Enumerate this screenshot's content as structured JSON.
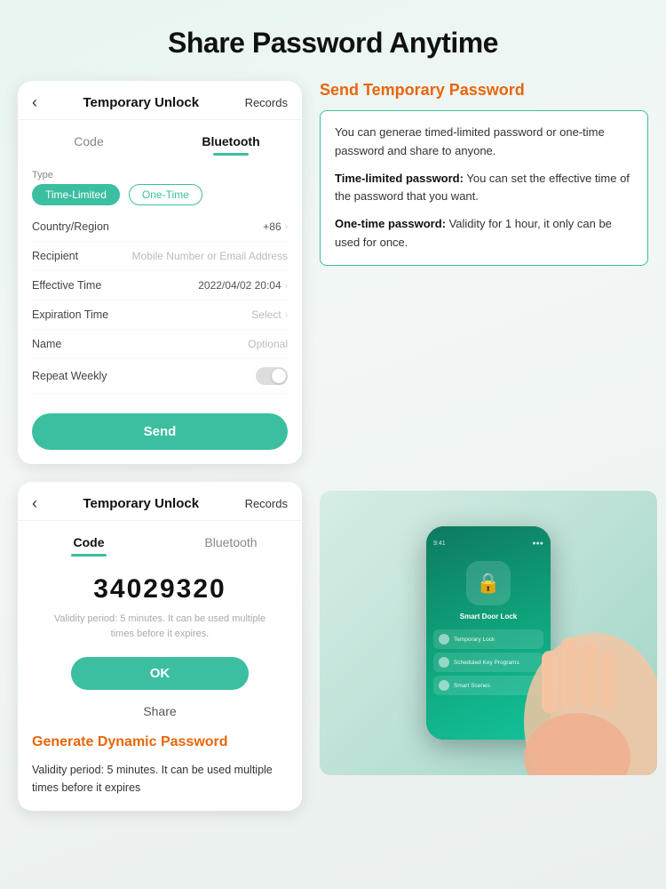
{
  "page": {
    "title": "Share Password Anytime",
    "background_color": "#e8f5f0"
  },
  "top_phone": {
    "header": {
      "back_icon": "‹",
      "title": "Temporary Unlock",
      "records_link": "Records"
    },
    "tabs": [
      {
        "label": "Code",
        "active": false
      },
      {
        "label": "Bluetooth",
        "active": true
      }
    ],
    "form": {
      "type_label": "Type",
      "type_options": [
        {
          "label": "Time-Limited",
          "active": true
        },
        {
          "label": "One-Time",
          "active": false
        }
      ],
      "fields": [
        {
          "name": "Country/Region",
          "value": "+86",
          "has_value": true,
          "has_chevron": true
        },
        {
          "name": "Recipient",
          "value": "Mobile Number or Email Address",
          "has_value": false,
          "has_chevron": false
        },
        {
          "name": "Effective Time",
          "value": "2022/04/02 20:04",
          "has_value": true,
          "has_chevron": true
        },
        {
          "name": "Expiration Time",
          "value": "Select",
          "has_value": false,
          "has_chevron": true
        },
        {
          "name": "Name",
          "value": "Optional",
          "has_value": false,
          "has_chevron": false
        },
        {
          "name": "Repeat Weekly",
          "value": "toggle",
          "has_value": false,
          "has_chevron": false
        }
      ],
      "send_button": "Send"
    }
  },
  "send_password_info": {
    "title": "Send Temporary Password",
    "description": "You can generae timed-limited password or one-time password and share to anyone.",
    "time_limited_label": "Time-limited password:",
    "time_limited_text": "You can set the effective time of the password that you want.",
    "one_time_label": "One-time password:",
    "one_time_text": "Validity for 1 hour, it only can be used for once."
  },
  "bottom_phone": {
    "header": {
      "back_icon": "‹",
      "title": "Temporary Unlock",
      "records_link": "Records"
    },
    "tabs": [
      {
        "label": "Code",
        "active": true
      },
      {
        "label": "Bluetooth",
        "active": false
      }
    ],
    "code": "34029320",
    "validity_text": "Validity period: 5 minutes. It can be used multiple times before it expires.",
    "ok_button": "OK",
    "share_button": "Share"
  },
  "dynamic_password_info": {
    "title": "Generate Dynamic Password",
    "description": "Validity period: 5 minutes. It can be used multiple times before it expires"
  },
  "mini_phone": {
    "status_left": "9:41",
    "status_right": "●●●",
    "lock_icon": "🔒",
    "app_title": "Smart Door Lock",
    "menu_items": [
      {
        "label": "Temporary Lock"
      },
      {
        "label": "Scheduled Key Programs"
      },
      {
        "label": "Smart Scenes"
      }
    ]
  },
  "colors": {
    "teal": "#3bbfa0",
    "orange": "#e8660a",
    "dark": "#111111",
    "gray": "#888888",
    "border_teal": "#3bbfa0"
  }
}
